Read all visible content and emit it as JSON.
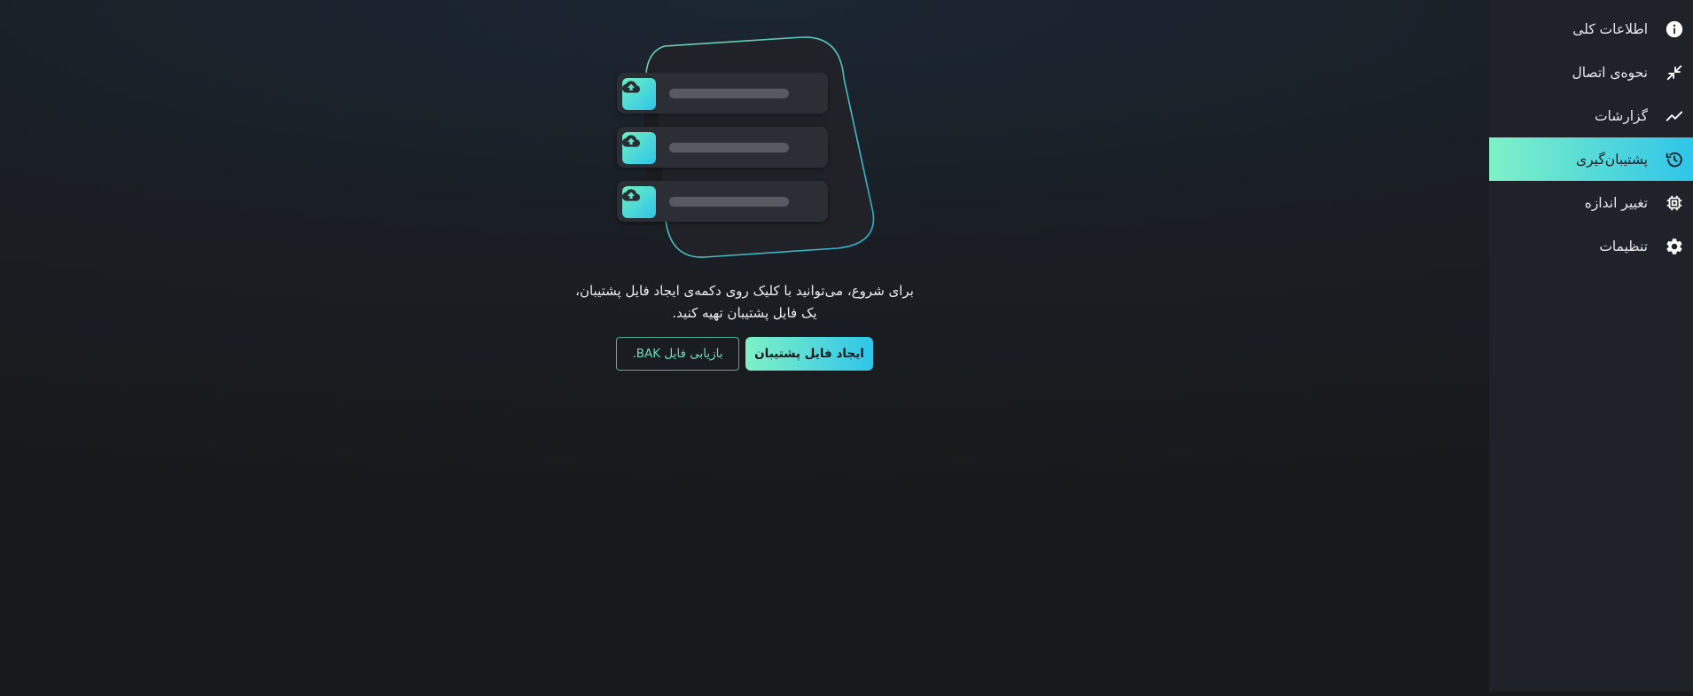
{
  "sidebar": {
    "items": [
      {
        "label": "اطلاعات کلی",
        "icon": "info-icon",
        "active": false
      },
      {
        "label": "نحوه‌ی اتصال",
        "icon": "compress-arrows-icon",
        "active": false
      },
      {
        "label": "گزارشات",
        "icon": "trend-line-icon",
        "active": false
      },
      {
        "label": "پشتیبان‌گیری",
        "icon": "history-clock-icon",
        "active": true
      },
      {
        "label": "تغییر اندازه",
        "icon": "chip-icon",
        "active": false
      },
      {
        "label": "تنظیمات",
        "icon": "gear-icon",
        "active": false
      }
    ]
  },
  "empty_state": {
    "illustration_rows": [
      {
        "icon": "cloud-upload-icon"
      },
      {
        "icon": "cloud-upload-icon"
      },
      {
        "icon": "cloud-upload-icon"
      }
    ],
    "message_line1": "برای شروع، می‌توانید با کلیک روی دکمه‌ی ایجاد فایل پشتیبان،",
    "message_line2": "یک فایل پشتیبان تهیه کنید.",
    "create_button_label": "ایجاد فایل پشتیبان",
    "restore_button_label": "بازیابی فایل BAK."
  },
  "colors": {
    "accent_start": "#7ff1c6",
    "accent_end": "#2fc5ea",
    "sidebar_bg": "#1f2228",
    "page_bg": "#18191b"
  }
}
